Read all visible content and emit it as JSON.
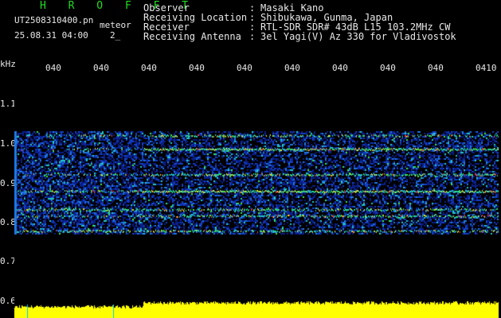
{
  "header": {
    "station_title": "H R O F F T",
    "file_name": "UT2508310400.pn",
    "meteor_label": "meteor",
    "date_time": "25.08.31 04:00",
    "counter": "2_",
    "rows": [
      {
        "label": "Observer",
        "sep": ":",
        "value": "Masaki Kano"
      },
      {
        "label": "Receiving Location",
        "sep": ":",
        "value": "Shibukawa, Gunma, Japan"
      },
      {
        "label": "Receiver",
        "sep": ":",
        "value": "RTL-SDR SDR# 43dB L15 103.2MHz CW"
      },
      {
        "label": "Receiving Antenna",
        "sep": ":",
        "value": "3el Yagi(V) Az 330 for Vladivostok"
      }
    ]
  },
  "axis": {
    "unit": "kHz",
    "y_labels": [
      "1.1",
      "1.0",
      "0.9",
      "0.8",
      "0.7",
      "0.6"
    ],
    "x_labels": [
      "040",
      "040",
      "040",
      "040",
      "040",
      "040",
      "040",
      "040",
      "040",
      "0410"
    ]
  },
  "colors": {
    "background": "#000000",
    "title": "#22dd22",
    "text": "#e8e8e8",
    "bar_fill": "#ffff00",
    "bar_marker": "#00ccff"
  }
}
